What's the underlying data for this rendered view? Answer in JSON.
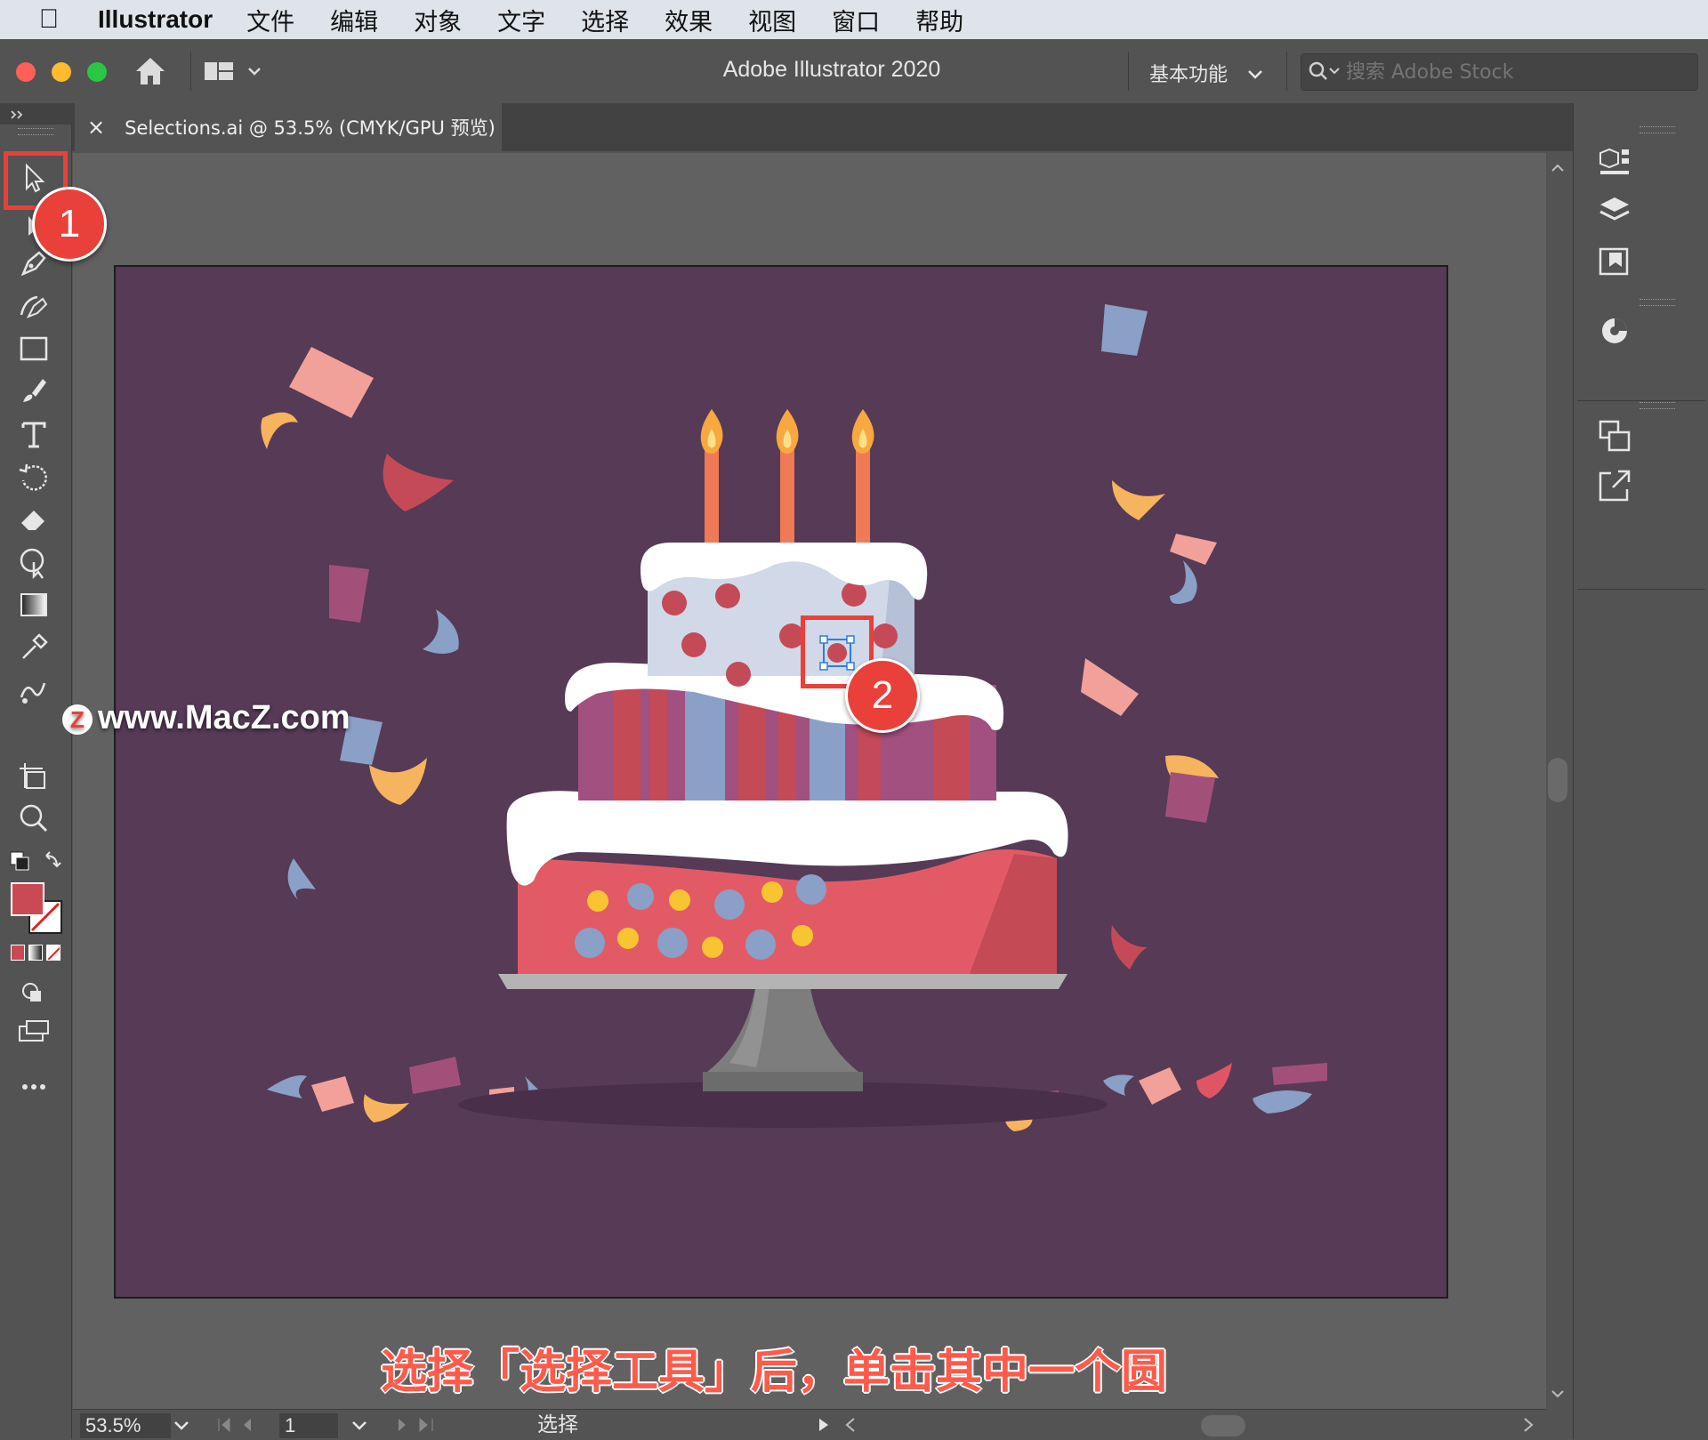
{
  "menubar": {
    "app_name": "Illustrator",
    "items": [
      "文件",
      "编辑",
      "对象",
      "文字",
      "选择",
      "效果",
      "视图",
      "窗口",
      "帮助"
    ]
  },
  "titlebar": {
    "title": "Adobe Illustrator 2020",
    "workspace": "基本功能",
    "search_placeholder": "搜索 Adobe Stock"
  },
  "document_tab": {
    "close_glyph": "×",
    "label": "Selections.ai @ 53.5% (CMYK/GPU 预览)"
  },
  "callouts": {
    "step1": "1",
    "step2": "2",
    "caption": "选择「选择工具」后，单击其中一个圆"
  },
  "watermark": {
    "text": "www.MacZ.com",
    "logo_letter": "Z"
  },
  "statusbar": {
    "zoom": "53.5%",
    "artboard_number": "1",
    "status_text": "选择"
  },
  "colors": {
    "accent_red": "#e9403a",
    "artboard_bg": "#563a56",
    "fill_swatch": "#c94a55"
  }
}
